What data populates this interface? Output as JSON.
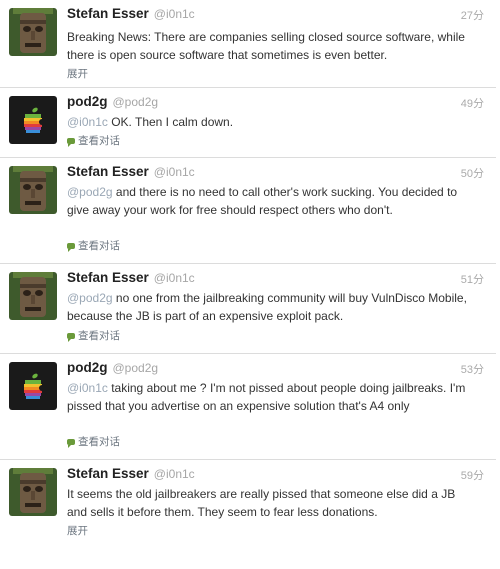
{
  "tweets": [
    {
      "name": "Stefan Esser",
      "handle": "@i0n1c",
      "time": "27分",
      "avatar": "tiki-mask-avatar",
      "mention": "",
      "text": "Breaking News: There are companies selling closed source software, while there is open source software that sometimes is even better.",
      "action": "展开",
      "action_icon": ""
    },
    {
      "name": "pod2g",
      "handle": "@pod2g",
      "time": "49分",
      "avatar": "apple-logo-avatar",
      "mention": "@i0n1c",
      "text": " OK. Then I calm down.",
      "action": "查看对话",
      "action_icon": "conversation-bubble-icon"
    },
    {
      "name": "Stefan Esser",
      "handle": "@i0n1c",
      "time": "50分",
      "avatar": "tiki-mask-avatar",
      "mention": "@pod2g",
      "text": " and there is no need to call other's work sucking. You decided to give away your work for free should respect others who don't.",
      "action": "查看对话",
      "action_icon": "conversation-bubble-icon"
    },
    {
      "name": "Stefan Esser",
      "handle": "@i0n1c",
      "time": "51分",
      "avatar": "tiki-mask-avatar",
      "mention": "@pod2g",
      "text": " no one from the jailbreaking community will buy VulnDisco Mobile, because the JB is part of an expensive exploit pack.",
      "action": "查看对话",
      "action_icon": "conversation-bubble-icon"
    },
    {
      "name": "pod2g",
      "handle": "@pod2g",
      "time": "53分",
      "avatar": "apple-logo-avatar",
      "mention": "@i0n1c",
      "text": " taking about me ? I'm not pissed about people doing jailbreaks. I'm pissed that you advertise on an expensive solution that's A4 only",
      "action": "查看对话",
      "action_icon": "conversation-bubble-icon"
    },
    {
      "name": "Stefan Esser",
      "handle": "@i0n1c",
      "time": "59分",
      "avatar": "tiki-mask-avatar",
      "mention": "",
      "text": "It seems the old jailbreakers are really pissed that someone else did a JB and sells it before them. They seem to fear less donations.",
      "action": "展开",
      "action_icon": ""
    }
  ]
}
